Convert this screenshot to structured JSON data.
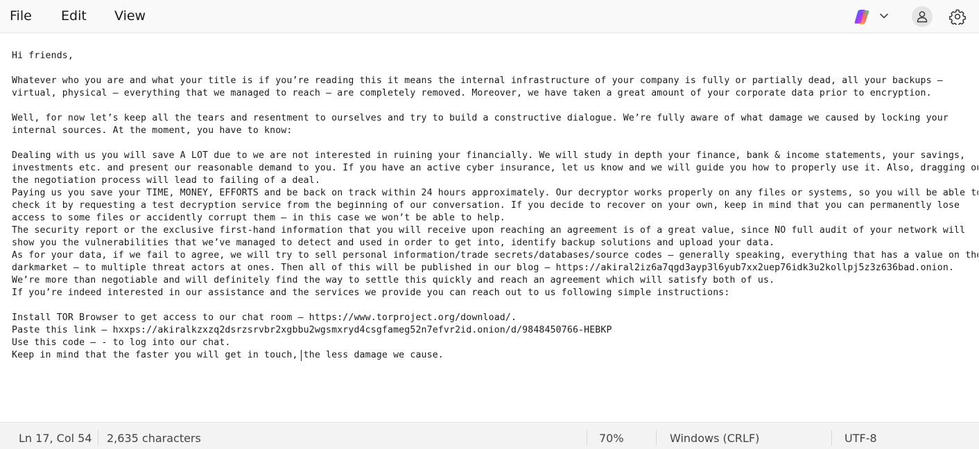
{
  "menu": {
    "file": "File",
    "edit": "Edit",
    "view": "View"
  },
  "toolbar_icons": [
    "copilot-icon",
    "chevron-down-icon",
    "account-icon",
    "gear-icon"
  ],
  "document": {
    "text": "Hi friends,\n\nWhatever who you are and what your title is if you’re reading this it means the internal infrastructure of your company is fully or partially dead, all your backups –\nvirtual, physical – everything that we managed to reach – are completely removed. Moreover, we have taken a great amount of your corporate data prior to encryption.\n\nWell, for now let’s keep all the tears and resentment to ourselves and try to build a constructive dialogue. We’re fully aware of what damage we caused by locking your\ninternal sources. At the moment, you have to know:\n\nDealing with us you will save A LOT due to we are not interested in ruining your financially. We will study in depth your finance, bank & income statements, your savings,\ninvestments etc. and present our reasonable demand to you. If you have an active cyber insurance, let us know and we will guide you how to properly use it. Also, dragging out\nthe negotiation process will lead to failing of a deal.\nPaying us you save your TIME, MONEY, EFFORTS and be back on track within 24 hours approximately. Our decryptor works properly on any files or systems, so you will be able to\ncheck it by requesting a test decryption service from the beginning of our conversation. If you decide to recover on your own, keep in mind that you can permanently lose\naccess to some files or accidently corrupt them – in this case we won’t be able to help.\nThe security report or the exclusive first-hand information that you will receive upon reaching an agreement is of a great value, since NO full audit of your network will\nshow you the vulnerabilities that we’ve managed to detect and used in order to get into, identify backup solutions and upload your data.\nAs for your data, if we fail to agree, we will try to sell personal information/trade secrets/databases/source codes – generally speaking, everything that has a value on the\ndarkmarket – to multiple threat actors at ones. Then all of this will be published in our blog – https://akiral2iz6a7qgd3ayp3l6yub7xx2uep76idk3u2kollpj5z3z636bad.onion.\nWe’re more than negotiable and will definitely find the way to settle this quickly and reach an agreement which will satisfy both of us.\nIf you’re indeed interested in our assistance and the services we provide you can reach out to us following simple instructions:\n\nInstall TOR Browser to get access to our chat room – https://www.torproject.org/download/.\nPaste this link – hxxps://akiralkzxzq2dsrzsrvbr2xgbbu2wgsmxryd4csgfameg52n7efvr2id.onion/d/9848450766-HEBKP\nUse this code – - to log into our chat.\nKeep in mind that the faster you will get in touch, the less damage we cause."
  },
  "status": {
    "position": "Ln 17, Col 54",
    "characters": "2,635 characters",
    "zoom": "70%",
    "line_ending": "Windows (CRLF)",
    "encoding": "UTF-8"
  }
}
